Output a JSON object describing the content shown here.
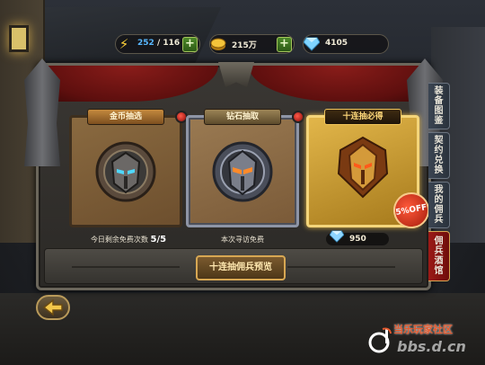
{
  "resources": {
    "energy": {
      "current": "252",
      "sep": "/",
      "max": "116",
      "icon": "lightning-icon",
      "color": "#58b8ff"
    },
    "gold": {
      "value": "215万",
      "icon": "gold-coin-icon"
    },
    "gems": {
      "value": "4105",
      "icon": "diamond-icon"
    },
    "plus": "+"
  },
  "cards": [
    {
      "title": "金币抽选",
      "caption_prefix": "今日剩余免费次数 ",
      "count": "5/5",
      "icon": "bronze-helmet-icon"
    },
    {
      "title": "钻石抽取",
      "caption": "本次寻访免费",
      "icon": "steel-helmet-icon"
    },
    {
      "title": "十连抽必得",
      "badge": "5%OFF",
      "price": "950",
      "icon": "gold-helmet-icon"
    }
  ],
  "preview_button": "十连抽佣兵预览",
  "tabs": [
    {
      "label": "装备图鉴",
      "active": false
    },
    {
      "label": "契约兑换",
      "active": false
    },
    {
      "label": "我的佣兵",
      "active": false
    },
    {
      "label": "佣兵酒馆",
      "active": true
    }
  ],
  "back_icon": "back-arrow-icon",
  "watermark": {
    "name": "当乐玩家社区",
    "url": "bbs.d.cn"
  },
  "colors": {
    "accent_gold": "#d7a753",
    "tab_active": "#9c1a17",
    "panel": "#3a3733"
  }
}
